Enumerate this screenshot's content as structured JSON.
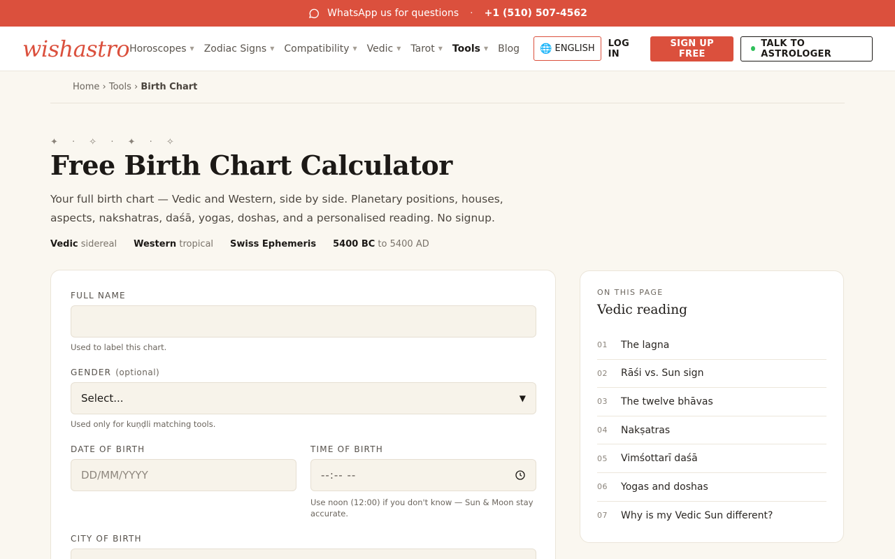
{
  "topbar": {
    "whatsapp_label": "WhatsApp us for questions",
    "separator": "·",
    "phone": "+1 (510) 507-4562"
  },
  "header": {
    "logo": "wishastro",
    "nav": [
      {
        "label": "Horoscopes",
        "has_caret": true
      },
      {
        "label": "Zodiac Signs",
        "has_caret": true
      },
      {
        "label": "Compatibility",
        "has_caret": true
      },
      {
        "label": "Vedic",
        "has_caret": true
      },
      {
        "label": "Tarot",
        "has_caret": true
      },
      {
        "label": "Tools",
        "has_caret": true,
        "active": true
      },
      {
        "label": "Blog",
        "has_caret": false
      }
    ],
    "language": "ENGLISH",
    "login": "LOG IN",
    "signup": "SIGN UP FREE",
    "talk": "TALK TO ASTROLOGER"
  },
  "breadcrumb": {
    "home": "Home",
    "sep": "›",
    "tools": "Tools",
    "current": "Birth Chart"
  },
  "hero": {
    "sparkles": "✦ · ✧ · ✦ · ✧",
    "title": "Free Birth Chart Calculator",
    "subtitle": "Your full birth chart — Vedic and Western, side by side. Planetary positions, houses, aspects, nakshatras, daśā, yogas, doshas, and a personalised reading. No signup.",
    "meta": [
      {
        "bold": "Vedic",
        "light": "sidereal"
      },
      {
        "bold": "Western",
        "light": "tropical"
      },
      {
        "bold": "Swiss Ephemeris",
        "light": ""
      },
      {
        "bold": "5400 BC",
        "light": "to 5400 AD"
      }
    ]
  },
  "form": {
    "full_name": {
      "label": "FULL NAME",
      "value": "",
      "placeholder": "",
      "hint": "Used to label this chart."
    },
    "gender": {
      "label": "GENDER",
      "optional": "(optional)",
      "value": "Select...",
      "hint": "Used only for kuṇḍli matching tools."
    },
    "dob": {
      "label": "DATE OF BIRTH",
      "placeholder": "DD/MM/YYYY"
    },
    "tob": {
      "label": "TIME OF BIRTH",
      "placeholder": "--:-- --",
      "hint": "Use noon (12:00) if you don't know — Sun & Moon stay accurate."
    },
    "city": {
      "label": "CITY OF BIRTH"
    }
  },
  "toc": {
    "eyebrow": "ON THIS PAGE",
    "title": "Vedic reading",
    "items": [
      {
        "num": "01",
        "label": "The lagna"
      },
      {
        "num": "02",
        "label": "Rāśi vs. Sun sign"
      },
      {
        "num": "03",
        "label": "The twelve bhāvas"
      },
      {
        "num": "04",
        "label": "Nakṣatras"
      },
      {
        "num": "05",
        "label": "Vimśottarī daśā"
      },
      {
        "num": "06",
        "label": "Yogas and doshas"
      },
      {
        "num": "07",
        "label": "Why is my Vedic Sun different?"
      }
    ]
  },
  "colors": {
    "accent": "#db503d",
    "background": "#faf7f0",
    "online": "#2fbf5a"
  },
  "icons": {
    "whatsapp": "chat-bubble-icon",
    "globe": "globe-icon",
    "clock": "clock-icon",
    "select_arrow": "triangle-down-icon"
  }
}
